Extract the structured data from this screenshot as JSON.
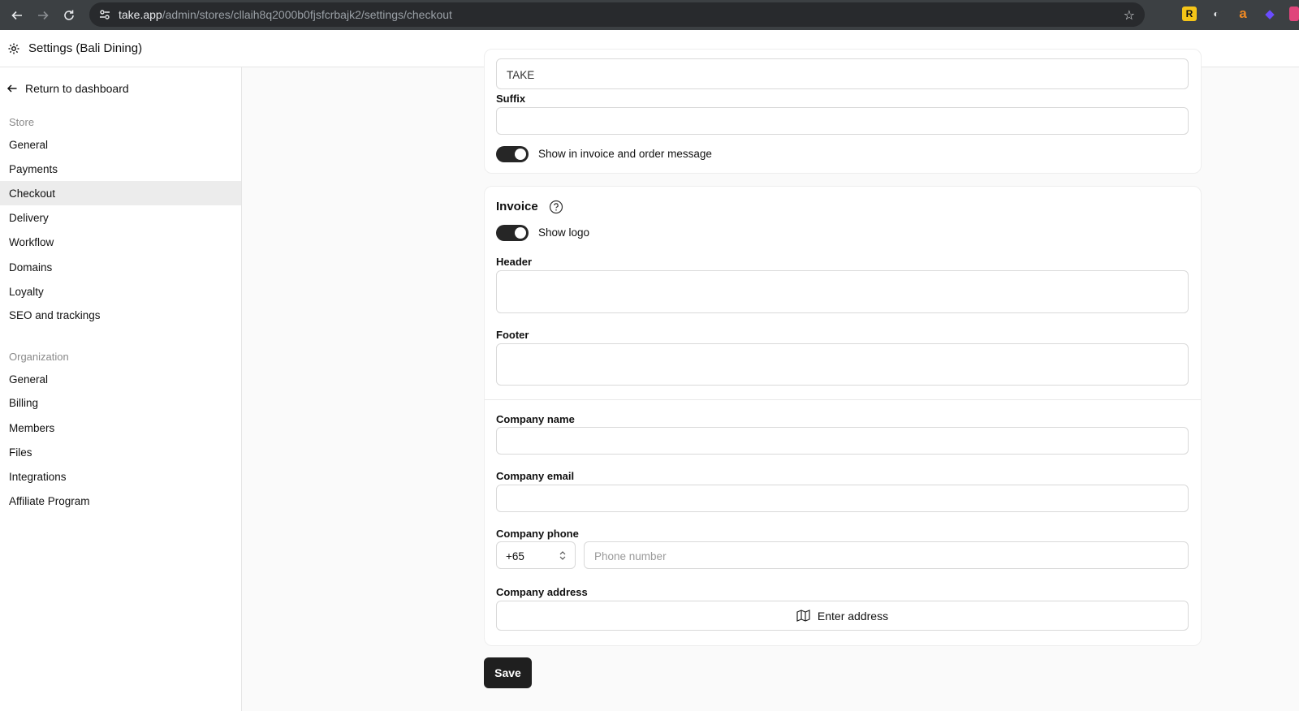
{
  "browser": {
    "url_host": "take.app",
    "url_path": "/admin/stores/cllaih8q2000b0fjsfcrbajk2/settings/checkout"
  },
  "header": {
    "title": "Settings (Bali Dining)"
  },
  "sidebar": {
    "return_label": "Return to dashboard",
    "store_label": "Store",
    "store_items": [
      "General",
      "Payments",
      "Checkout",
      "Delivery",
      "Workflow",
      "Domains",
      "Loyalty",
      "SEO and trackings"
    ],
    "active_item": "Checkout",
    "org_label": "Organization",
    "org_items": [
      "General",
      "Billing",
      "Members",
      "Files",
      "Integrations",
      "Affiliate Program"
    ]
  },
  "order_number": {
    "prefix_value": "TAKE",
    "suffix_label": "Suffix",
    "suffix_value": "",
    "show_toggle_label": "Show in invoice and order message",
    "show_toggle_on": true
  },
  "invoice": {
    "title": "Invoice",
    "show_logo_label": "Show logo",
    "show_logo_on": true,
    "header_label": "Header",
    "footer_label": "Footer",
    "company_name_label": "Company name",
    "company_email_label": "Company email",
    "company_phone_label": "Company phone",
    "country_code": "+65",
    "phone_placeholder": "Phone number",
    "company_address_label": "Company address",
    "enter_address_label": "Enter address"
  },
  "actions": {
    "save_label": "Save"
  },
  "colors": {
    "accent": "#1f1f1f",
    "chrome": "#3c4043"
  }
}
